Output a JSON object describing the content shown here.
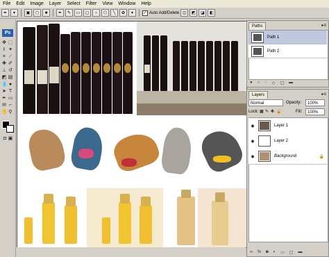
{
  "menu": [
    "File",
    "Edit",
    "Image",
    "Layer",
    "Select",
    "Filter",
    "View",
    "Window",
    "Help"
  ],
  "options": {
    "auto_add_delete_label": "Auto Add/Delete",
    "auto_add_delete_checked": "✓"
  },
  "app_badge": "Ps",
  "paths": {
    "tab": "Paths",
    "items": [
      {
        "label": "Path 1"
      },
      {
        "label": "Path 2"
      }
    ]
  },
  "layers": {
    "tab": "Layers",
    "blend_mode": "Normal",
    "opacity_label": "Opacity:",
    "opacity_value": "100%",
    "lock_label": "Lock:",
    "fill_label": "Fill:",
    "fill_value": "100%",
    "items": [
      {
        "label": "Layer 1"
      },
      {
        "label": "Layer 2"
      },
      {
        "label": "Background"
      }
    ]
  },
  "colors": {
    "accent": "#2a5fb0",
    "panel": "#d4d0c8",
    "selected": "#c0c8e0"
  },
  "icons": {
    "eye": "eye-icon",
    "lock": "lock-icon"
  }
}
